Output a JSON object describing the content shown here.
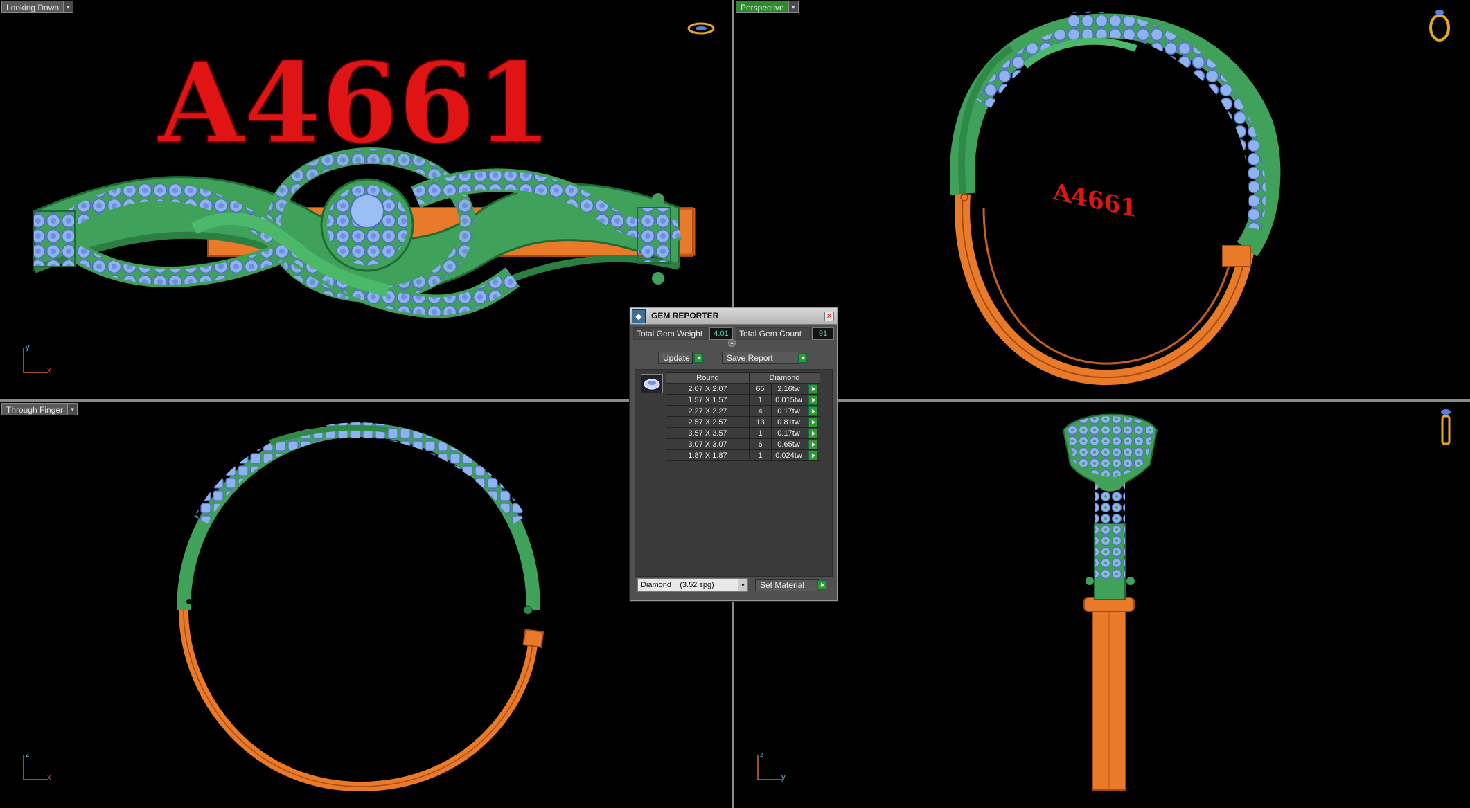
{
  "viewports": {
    "top_left": {
      "label": "Looking Down",
      "axis_v": "y",
      "axis_h": "x"
    },
    "top_right": {
      "label": "Perspective"
    },
    "bottom_left": {
      "label": "Through Finger",
      "axis_v": "z",
      "axis_h": "x"
    },
    "bottom_right": {
      "axis_v": "z",
      "axis_h": "y"
    }
  },
  "engraving": {
    "text": "A4661",
    "mirrored_text": "A4661",
    "color": "#e01414"
  },
  "colors": {
    "metal_green": "#3fa15a",
    "metal_orange": "#e87a2a",
    "gem_blue": "#8fb3f0"
  },
  "gem_reporter": {
    "title": "GEM REPORTER",
    "total_weight_label": "Total Gem Weight",
    "total_weight_value": "4.01",
    "total_count_label": "Total Gem Count",
    "total_count_value": "91",
    "update_label": "Update",
    "save_report_label": "Save Report",
    "table": {
      "col_shape": "Round",
      "col_material": "Diamond",
      "rows": [
        {
          "size": "2.07 X 2.07",
          "count": "65",
          "weight": "2.16tw"
        },
        {
          "size": "1.57 X 1.57",
          "count": "1",
          "weight": "0.015tw"
        },
        {
          "size": "2.27 X 2.27",
          "count": "4",
          "weight": "0.17tw"
        },
        {
          "size": "2.57 X 2.57",
          "count": "13",
          "weight": "0.81tw"
        },
        {
          "size": "3.57 X 3.57",
          "count": "1",
          "weight": "0.17tw"
        },
        {
          "size": "3.07 X 3.07",
          "count": "6",
          "weight": "0.65tw"
        },
        {
          "size": "1.87 X 1.87",
          "count": "1",
          "weight": "0.024tw"
        }
      ]
    },
    "material_select": "Diamond    (3.52 spg)",
    "set_material_label": "Set Material"
  }
}
